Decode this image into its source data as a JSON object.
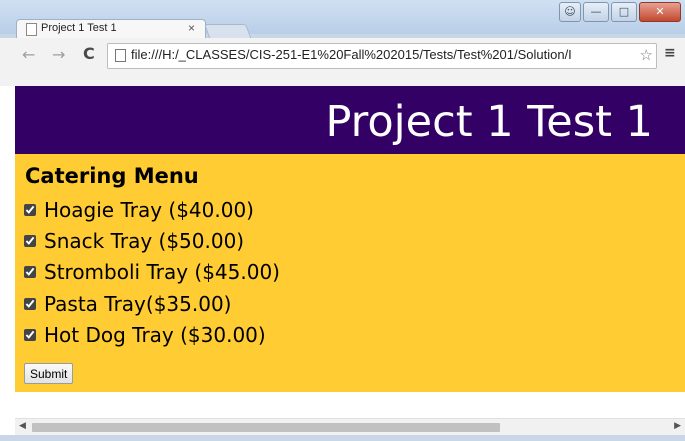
{
  "browser": {
    "tab_title": "Project 1 Test 1",
    "tab_close": "×",
    "url": "file:///H:/_CLASSES/CIS-251-E1%20Fall%202015/Tests/Test%201/Solution/I",
    "icons": {
      "back": "back-arrow-icon",
      "forward": "forward-arrow-icon",
      "reload": "reload-icon",
      "bookmark": "star-icon",
      "menu": "hamburger-menu-icon"
    }
  },
  "page": {
    "header_title": "Project 1 Test 1",
    "header_bg": "#330066",
    "menu_bg": "#ffcc33",
    "menu_heading": "Catering Menu",
    "items": [
      {
        "label": "Hoagie Tray ($40.00)",
        "checked": true
      },
      {
        "label": "Snack Tray ($50.00)",
        "checked": true
      },
      {
        "label": "Stromboli Tray ($45.00)",
        "checked": true
      },
      {
        "label": "Pasta Tray($35.00)",
        "checked": true
      },
      {
        "label": "Hot Dog Tray ($30.00)",
        "checked": true
      }
    ],
    "submit_label": "Submit"
  }
}
